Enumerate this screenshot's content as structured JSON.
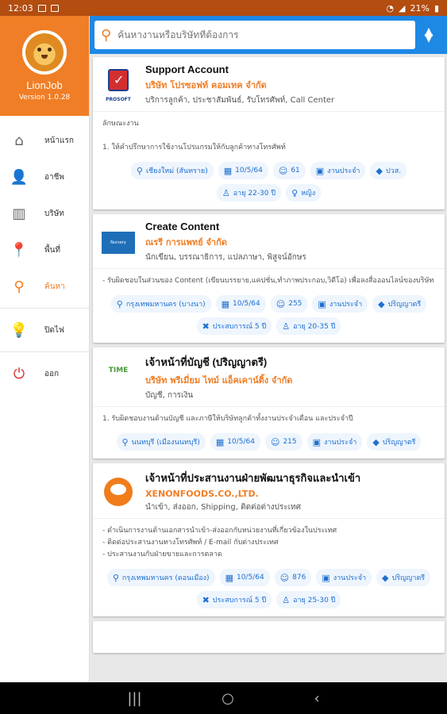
{
  "status_bar": {
    "time": "12:03",
    "battery": "21%"
  },
  "app": {
    "name": "LionJob",
    "version": "Version 1.0.28"
  },
  "sidebar": {
    "items": [
      {
        "label": "หน้าแรก",
        "icon": "home-icon",
        "glyph": "⌂",
        "active": false
      },
      {
        "label": "อาชีพ",
        "icon": "person-icon",
        "glyph": "👤",
        "active": false
      },
      {
        "label": "บริษัท",
        "icon": "building-icon",
        "glyph": "▥",
        "active": false
      },
      {
        "label": "พื้นที่",
        "icon": "location-icon",
        "glyph": "📍",
        "active": false
      },
      {
        "label": "ค้นหา",
        "icon": "search-icon",
        "glyph": "🔍",
        "active": true
      }
    ],
    "extra": [
      {
        "label": "ปิดไฟ",
        "icon": "lightbulb-icon",
        "glyph": "💡"
      },
      {
        "label": "ออก",
        "icon": "power-icon",
        "glyph": "⏻"
      }
    ]
  },
  "search": {
    "placeholder": "ค้นหางานหรือบริษัทที่ต้องการ"
  },
  "jobs": [
    {
      "title": "Support Account",
      "company": "บริษัท โปรซอฟท์ คอมเทค จำกัด",
      "category": "บริการลูกค้า, ประชาสัมพันธ์, รับโทรศัพท์, Call Center",
      "logo_text": "PROSOFT",
      "description": "ลักษณะงาน\n\n1. ให้คำปรึกษาการใช้งานโปรแกรมให้กับลูกค้าทางโทรศัพท์",
      "tags": [
        {
          "icon": "location-icon",
          "glyph": "📍",
          "text": "เชียงใหม่ (สันทราย)"
        },
        {
          "icon": "calendar-icon",
          "glyph": "📅",
          "text": "10/5/64"
        },
        {
          "icon": "smile-icon",
          "glyph": "☺",
          "text": "61"
        },
        {
          "icon": "badge-icon",
          "glyph": "🪪",
          "text": "งานประจำ"
        },
        {
          "icon": "graduation-icon",
          "glyph": "🎓",
          "text": "ปวส."
        },
        {
          "icon": "person-icon",
          "glyph": "♙",
          "text": "อายุ 22-30 ปี"
        },
        {
          "icon": "female-icon",
          "glyph": "♀",
          "text": "หญิง"
        }
      ]
    },
    {
      "title": "Create Content",
      "company": "ณรรี การแพทย์ จำกัด",
      "category": "นักเขียน, บรรณาธิการ, แปลภาษา, พิสูจน์อักษร",
      "logo_text": "Nursery",
      "description": "- รับผิดชอบในส่วนของ Content (เขียนบรรยาย,แคปชั่น,ทำภาพประกอบ,วิดีโอ) เพื่อลงสื่อออนไลน์ของบริษัท",
      "tags": [
        {
          "icon": "location-icon",
          "glyph": "📍",
          "text": "กรุงเทพมหานคร (บางนา)"
        },
        {
          "icon": "calendar-icon",
          "glyph": "📅",
          "text": "10/5/64"
        },
        {
          "icon": "smile-icon",
          "glyph": "☺",
          "text": "255"
        },
        {
          "icon": "badge-icon",
          "glyph": "🪪",
          "text": "งานประจำ"
        },
        {
          "icon": "graduation-icon",
          "glyph": "🎓",
          "text": "ปริญญาตรี"
        },
        {
          "icon": "tools-icon",
          "glyph": "✖",
          "text": "ประสบการณ์ 5 ปี"
        },
        {
          "icon": "person-icon",
          "glyph": "♙",
          "text": "อายุ 20-35 ปี"
        }
      ]
    },
    {
      "title": "เจ้าหน้าที่บัญชี (ปริญญาตรี)",
      "company": "บริษัท พรีเมี่ยม ไทม์ แอ็คเคาน์ติ้ง จำกัด",
      "category": "บัญชี, การเงิน",
      "logo_text": "TIME",
      "description": "1. รับผิดชอบงานด้านบัญชี และภาษีให้บริษัทลูกค้าทั้งงานประจำเดือน และประจำปี",
      "tags": [
        {
          "icon": "location-icon",
          "glyph": "📍",
          "text": "นนทบุรี (เมืองนนทบุรี)"
        },
        {
          "icon": "calendar-icon",
          "glyph": "📅",
          "text": "10/5/64"
        },
        {
          "icon": "smile-icon",
          "glyph": "☺",
          "text": "215"
        },
        {
          "icon": "badge-icon",
          "glyph": "🪪",
          "text": "งานประจำ"
        },
        {
          "icon": "graduation-icon",
          "glyph": "🎓",
          "text": "ปริญญาตรี"
        }
      ]
    },
    {
      "title": "เจ้าหน้าที่ประสานงานฝ่ายพัฒนาธุรกิจและนำเข้า",
      "company": "XENONFOODS.CO.,LTD.",
      "category": "นำเข้า, ส่งออก, Shipping, ติดต่อต่างประเทศ",
      "logo_text": "XENON",
      "description": "- ดำเนินการงานด้านเอกสารนำเข้า-ส่งออกกับหน่วยงานที่เกี่ยวข้องในประเทศ\n- ติดต่อประสานงานทางโทรศัพท์ / E-mail กับต่างประเทศ\n- ประสานงานกับฝ่ายขายและการตลาด",
      "tags": [
        {
          "icon": "location-icon",
          "glyph": "📍",
          "text": "กรุงเทพมหานคร (ดอนเมือง)"
        },
        {
          "icon": "calendar-icon",
          "glyph": "📅",
          "text": "10/5/64"
        },
        {
          "icon": "smile-icon",
          "glyph": "☺",
          "text": "876"
        },
        {
          "icon": "badge-icon",
          "glyph": "🪪",
          "text": "งานประจำ"
        },
        {
          "icon": "graduation-icon",
          "glyph": "🎓",
          "text": "ปริญญาตรี"
        },
        {
          "icon": "tools-icon",
          "glyph": "✖",
          "text": "ประสบการณ์ 5 ปี"
        },
        {
          "icon": "person-icon",
          "glyph": "♙",
          "text": "อายุ 25-30 ปี"
        }
      ]
    }
  ],
  "nav_bar": {
    "recents": "|||",
    "home": "○",
    "back": "‹"
  }
}
